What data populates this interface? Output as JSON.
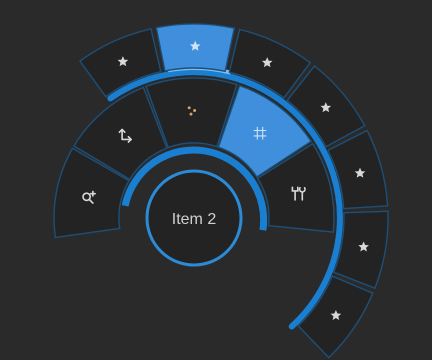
{
  "center": {
    "label": "Item 2"
  },
  "colors": {
    "background": "#2a2a2a",
    "segment_fill": "#232323",
    "segment_stroke": "#1d4f78",
    "selected_fill": "#3f8fdd",
    "accent": "#1a7fd0",
    "icon": "#d8d8d8",
    "icon_selected": "#cfe3f6",
    "dots": "#d3a76a",
    "text": "#d0d0d0"
  },
  "inner_ring": [
    {
      "name": "zoom-add-icon",
      "selected": false
    },
    {
      "name": "corner-arrows-icon",
      "selected": false
    },
    {
      "name": "scatter-dots-icon",
      "selected": false
    },
    {
      "name": "grid-icon",
      "selected": true
    },
    {
      "name": "tools-icon",
      "selected": false
    }
  ],
  "outer_ring": [
    {
      "name": "star-icon",
      "selected": false
    },
    {
      "name": "star-icon",
      "selected": true
    },
    {
      "name": "star-icon",
      "selected": false
    },
    {
      "name": "star-icon",
      "selected": false
    },
    {
      "name": "star-icon",
      "selected": false
    },
    {
      "name": "star-icon",
      "selected": false
    },
    {
      "name": "star-icon",
      "selected": false
    }
  ]
}
